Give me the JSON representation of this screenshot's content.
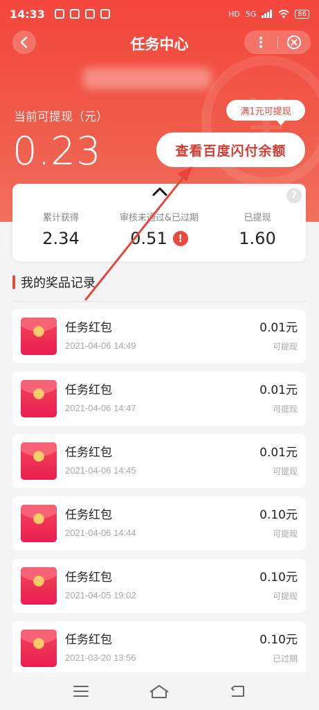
{
  "status_bar": {
    "time": "14:33",
    "network": "5G",
    "battery": "86"
  },
  "nav": {
    "title": "任务中心"
  },
  "balance": {
    "label": "当前可提现（元）",
    "value": "0.23",
    "tip": "满1元可提现",
    "button": "查看百度闪付余额"
  },
  "stats": [
    {
      "label": "累计获得",
      "value": "2.34"
    },
    {
      "label": "审核未通过&已过期",
      "value": "0.51"
    },
    {
      "label": "已提现",
      "value": "1.60"
    }
  ],
  "help_mark": "?",
  "warn_mark": "!",
  "section": {
    "title": "我的奖品记录"
  },
  "records": [
    {
      "title": "任务红包",
      "time": "2021-04-06 14:49",
      "amount": "0.01元",
      "status": "可提现"
    },
    {
      "title": "任务红包",
      "time": "2021-04-06 14:47",
      "amount": "0.01元",
      "status": "可提现"
    },
    {
      "title": "任务红包",
      "time": "2021-04-06 14:45",
      "amount": "0.01元",
      "status": "可提现"
    },
    {
      "title": "任务红包",
      "time": "2021-04-06 14:44",
      "amount": "0.10元",
      "status": "可提现"
    },
    {
      "title": "任务红包",
      "time": "2021-04-05 19:02",
      "amount": "0.10元",
      "status": "可提现"
    },
    {
      "title": "任务红包",
      "time": "2021-03-20 13:56",
      "amount": "0.10元",
      "status": "已过期"
    }
  ],
  "colors": {
    "primary": "#f4463c",
    "accent_text": "#d53b31",
    "envelope": "#e91e4f"
  }
}
